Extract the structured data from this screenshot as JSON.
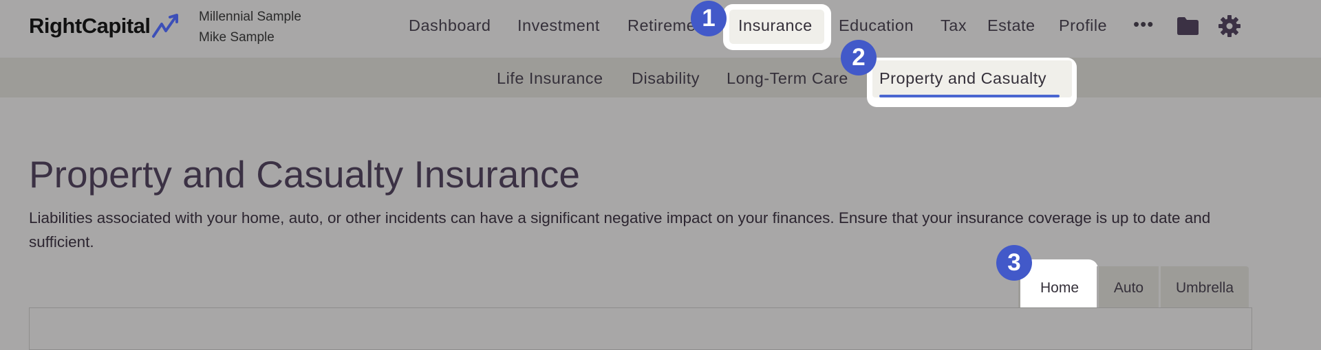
{
  "logo": {
    "text": "RightCapital"
  },
  "client": {
    "household": "Millennial Sample",
    "name": "Mike Sample"
  },
  "nav": {
    "items": [
      "Dashboard",
      "Investment",
      "Retireme",
      "Insurance",
      "Education",
      "Tax",
      "Estate",
      "Profile"
    ],
    "more": "•••",
    "folder_icon": "folder-icon",
    "settings_icon": "gear-icon"
  },
  "subnav": {
    "items": [
      "Life Insurance",
      "Disability",
      "Long-Term Care",
      "Property and Casualty"
    ]
  },
  "page": {
    "title": "Property and Casualty Insurance",
    "description": "Liabilities associated with your home, auto, or other incidents can have a significant negative impact on your finances. Ensure that your insurance coverage is up to date and sufficient."
  },
  "tabs": [
    "Home",
    "Auto",
    "Umbrella"
  ],
  "steps": [
    "1",
    "2",
    "3"
  ],
  "colors": {
    "accent": "#4259c9",
    "underline": "#4a66d0",
    "overlay": "#a8a7a7"
  }
}
